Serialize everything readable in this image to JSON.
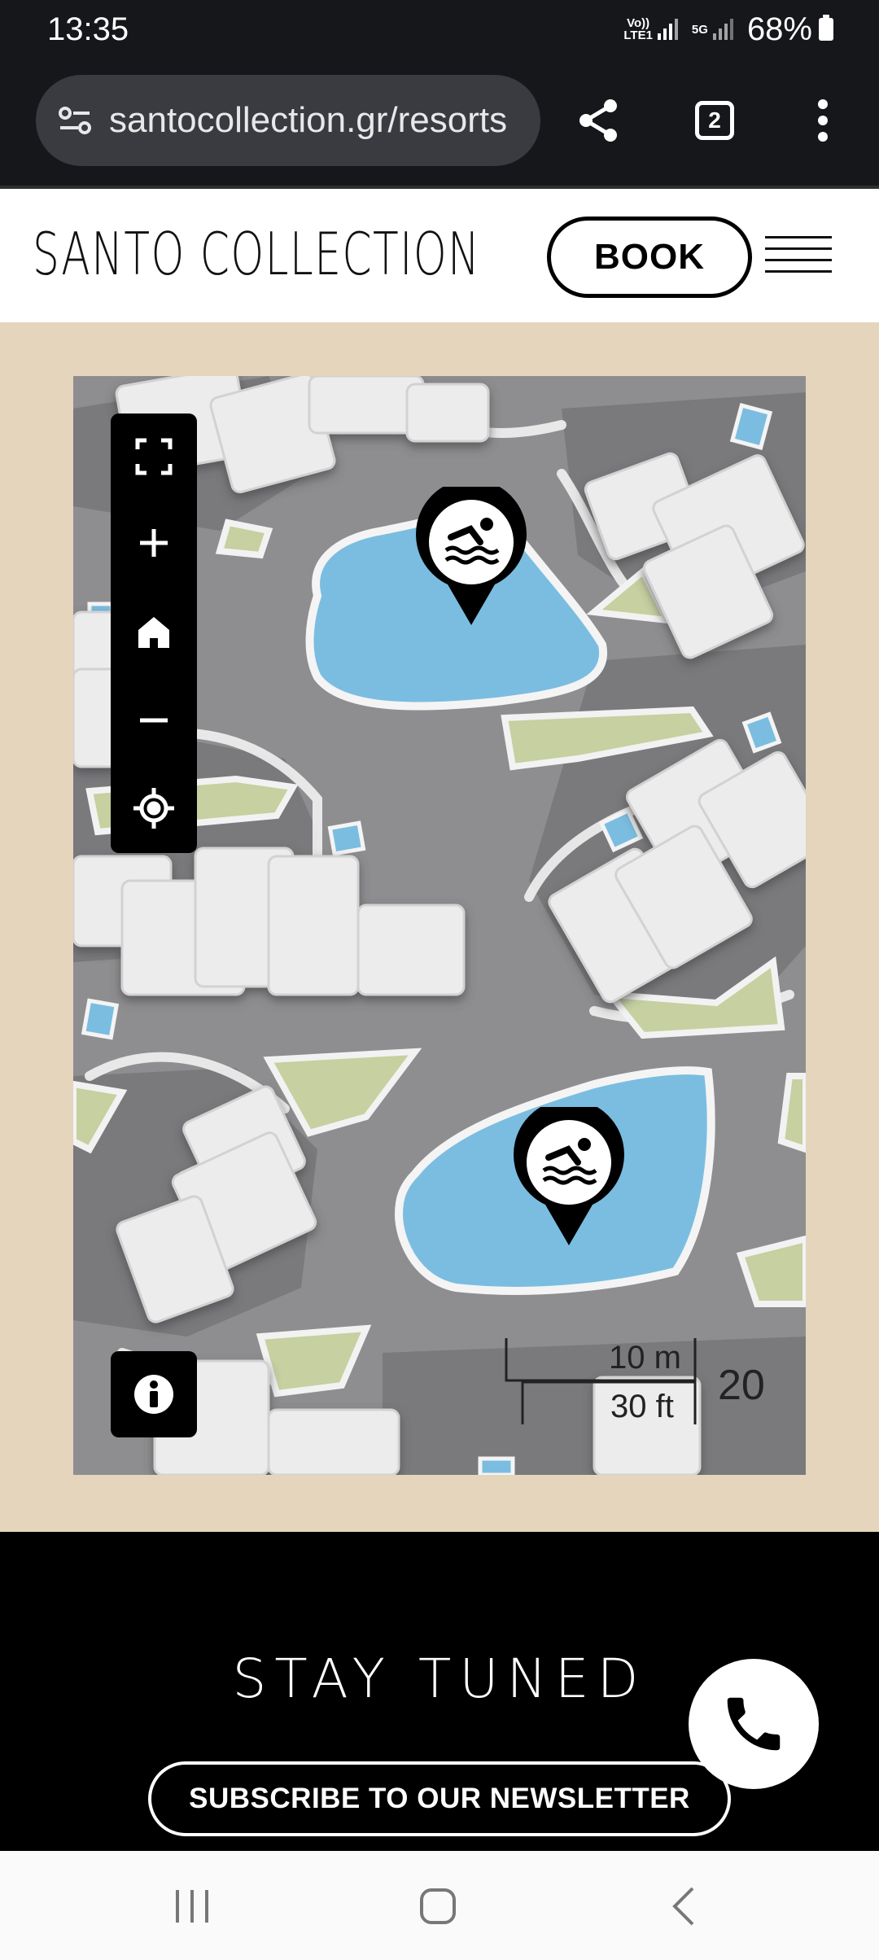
{
  "status_bar": {
    "time": "13:35",
    "network_1": "Vo)) LTE1",
    "network_2": "5G",
    "battery": "68%"
  },
  "browser": {
    "url": "santocollection.gr/resorts",
    "tab_count": "2",
    "icons": [
      "site-settings-icon",
      "share-icon",
      "tabs-icon",
      "more-vert-icon"
    ]
  },
  "site": {
    "logo": "SANTO COLLECTION",
    "book_label": "BOOK",
    "menu_icon": "hamburger-menu-icon"
  },
  "map": {
    "controls": [
      "fullscreen-icon",
      "zoom-in-icon",
      "home-icon",
      "zoom-out-icon",
      "locate-icon"
    ],
    "info_icon": "info-person-icon",
    "pins": [
      {
        "icon": "swimming-pool-icon"
      },
      {
        "icon": "swimming-pool-icon"
      }
    ],
    "scale_metric": "10 m",
    "scale_imperial": "30 ft",
    "zoom_level": "20"
  },
  "footer": {
    "heading": "STAY TUNED",
    "subscribe_label": "SUBSCRIBE TO OUR NEWSLETTER",
    "call_icon": "phone-icon"
  },
  "colors": {
    "chrome_bg": "#16171b",
    "beige": "#e4d5bc",
    "pool": "#7bbde0",
    "grass": "#c6d0a0",
    "road": "#8e8e90"
  }
}
